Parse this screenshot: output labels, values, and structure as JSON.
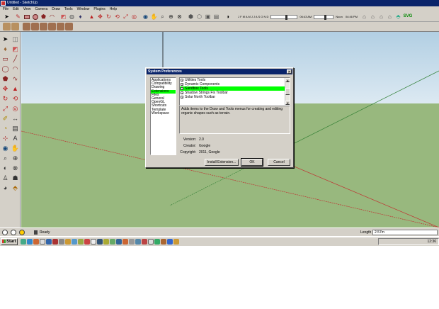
{
  "window": {
    "title": "Untitled - SketchUp"
  },
  "menu": [
    "File",
    "Edit",
    "View",
    "Camera",
    "Draw",
    "Tools",
    "Window",
    "Plugins",
    "Help"
  ],
  "shadow_bar": {
    "months": "J F M A M J J A S O N D",
    "time_start": "06:43 AM",
    "noon": "Noon",
    "time_end": "04:46 PM"
  },
  "status": {
    "text": "Ready",
    "length_label": "Length",
    "length_value": "2.57m"
  },
  "taskbar": {
    "start": "Start",
    "clock": "12:36"
  },
  "dialog": {
    "title": "System Preferences",
    "close": "×",
    "categories": [
      "Applications",
      "Compatibility",
      "Drawing",
      "Extensions",
      "Files",
      "General",
      "OpenGL",
      "Shortcuts",
      "Template",
      "Workspace"
    ],
    "selected_category": 3,
    "extensions": [
      {
        "label": "Utilities Tools",
        "checked": true
      },
      {
        "label": "Dynamic Components",
        "checked": true
      },
      {
        "label": "Sandbox Tools",
        "checked": true,
        "selected": true
      },
      {
        "label": "Shadow Strings Fix Toolbar",
        "checked": true
      },
      {
        "label": "Solar North Toolbar",
        "checked": true
      }
    ],
    "description": "Adds items to the Draw and Tools menus for creating and editing organic shapes such as terrain.",
    "version_label": "Version:",
    "version": "2.0",
    "creator_label": "Creator:",
    "creator": "Google",
    "copyright_label": "Copyright:",
    "copyright": "2011, Google",
    "btn_install": "Install Extension...",
    "btn_ok": "OK",
    "btn_cancel": "Cancel"
  },
  "colors": {
    "titlebar": "#0a246a",
    "chrome": "#d4d0c8",
    "ground": "#98b87e",
    "sky_top": "#b2cfe3",
    "selection": "#00ff00",
    "red_axis": "#c03030",
    "green_axis": "#2e7d32"
  }
}
